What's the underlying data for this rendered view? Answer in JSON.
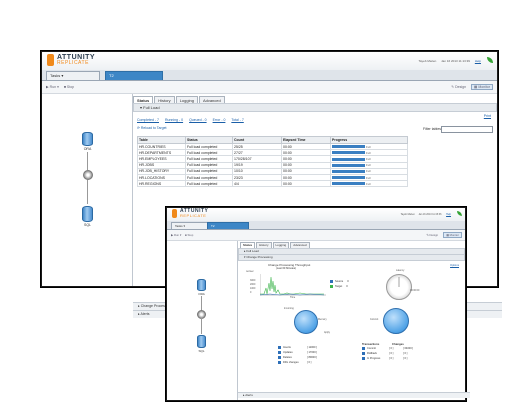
{
  "brand": {
    "name": "ATTUNITY",
    "sub": "REPLICATE"
  },
  "window1": {
    "header": {
      "user": "Tayeb Mazen",
      "datetime": "Jan 16 2013 11:13:39",
      "help": "Help"
    },
    "tabs": [
      {
        "label": "Tasks"
      },
      {
        "label": "T2"
      }
    ],
    "toolbar": {
      "run": "Run",
      "stop": "Stop",
      "design": "Design",
      "monitor": "Monitor"
    },
    "endpoints": {
      "source": "ORA",
      "target": "SQL"
    },
    "main_tabs": [
      {
        "label": "Status"
      },
      {
        "label": "History"
      },
      {
        "label": "Logging"
      },
      {
        "label": "Advanced"
      }
    ],
    "section": "Full Load",
    "print_link": "Print",
    "filters": [
      "Completed - 7",
      "Running - 0",
      "Queued - 0",
      "Error - 0",
      "Total - 7"
    ],
    "reload": "Reload to Target",
    "filter_label": "Filter tables:",
    "table": {
      "headers": [
        "Table",
        "Status",
        "Count",
        "Elapsed Time",
        "Progress"
      ],
      "rows": [
        {
          "table": "HR.COUNTRIES",
          "status": "Full load completed",
          "count": "25/25",
          "elapsed": "00:00",
          "progress": 1.0,
          "progress_label": "Full"
        },
        {
          "table": "HR.DEPARTMENTS",
          "status": "Full load completed",
          "count": "27/27",
          "elapsed": "00:00",
          "progress": 1.0,
          "progress_label": "Full"
        },
        {
          "table": "HR.EMPLOYEES",
          "status": "Full load completed",
          "count": "170/28/107",
          "elapsed": "00:00",
          "progress": 1.0,
          "progress_label": "Full"
        },
        {
          "table": "HR.JOBS",
          "status": "Full load completed",
          "count": "19/19",
          "elapsed": "00:00",
          "progress": 1.0,
          "progress_label": "Full"
        },
        {
          "table": "HR.JOB_HISTORY",
          "status": "Full load completed",
          "count": "10/10",
          "elapsed": "00:00",
          "progress": 1.0,
          "progress_label": "Full"
        },
        {
          "table": "HR.LOCATIONS",
          "status": "Full load completed",
          "count": "23/23",
          "elapsed": "00:00",
          "progress": 1.0,
          "progress_label": "Full"
        },
        {
          "table": "HR.REGIONS",
          "status": "Full load completed",
          "count": "4/4",
          "elapsed": "00:00",
          "progress": 1.0,
          "progress_label": "Full"
        }
      ]
    },
    "bottom": [
      "Change Processing",
      "Alerts"
    ]
  },
  "window2": {
    "header": {
      "user": "Tayeb Mazen",
      "datetime": "Jan 16 2013 11:15:36",
      "help": "Help"
    },
    "tabs": [
      {
        "label": "Tasks"
      },
      {
        "label": "T2"
      }
    ],
    "toolbar": {
      "run": "Run",
      "stop": "Stop",
      "design": "Design",
      "monitor": "Monitor"
    },
    "endpoints": {
      "source": "ORA",
      "target": "SQL"
    },
    "main_tabs": [
      {
        "label": "Status"
      },
      {
        "label": "History"
      },
      {
        "label": "Logging"
      },
      {
        "label": "Advanced"
      }
    ],
    "sections": [
      "Full Load",
      "Change Processing"
    ],
    "chart_link": "Options",
    "throughput": {
      "title": "Change Processing Throughput",
      "subtitle": "(Last 60 Minutes)",
      "ylabel": "rec/sec",
      "yticks": [
        "3000",
        "2000",
        "1000",
        "0"
      ],
      "xlabel": "Time",
      "series": [
        {
          "name": "Source",
          "value": "0",
          "color": "#2d6fb8"
        },
        {
          "name": "Target",
          "value": "0",
          "color": "#3cb44b"
        }
      ]
    },
    "latency": {
      "label": "Latency",
      "value": "00:00:00"
    },
    "pie_left": {
      "top": "Incoming",
      "left": "Apply",
      "right": "Memory"
    },
    "pie_right": {
      "left": "Commit"
    },
    "stats_left": [
      {
        "label": "Inserts",
        "value": "[ 11000 ]"
      },
      {
        "label": "Updates",
        "value": "[ 17000 ]"
      },
      {
        "label": "Deletes",
        "value": "[ 80000 ]"
      },
      {
        "label": "DDL changes",
        "value": "[ 0 ]"
      }
    ],
    "stats_right_headers": [
      "Transactions",
      "Changes"
    ],
    "stats_right": [
      {
        "label": "Commit",
        "v1": "[ 0 ]",
        "v2": "[ 64000 ]"
      },
      {
        "label": "Rollback",
        "v1": "[ 0 ]",
        "v2": "[ 0 ]"
      },
      {
        "label": "In Progress",
        "v1": "[ 0 ]",
        "v2": "[ 0 ]"
      }
    ],
    "bottom": [
      "Alerts"
    ]
  },
  "colors": {
    "accent": "#3d86c6",
    "brand_orange": "#f08a1c",
    "progress": "#3a7fc2",
    "leaf": "#35a335"
  }
}
